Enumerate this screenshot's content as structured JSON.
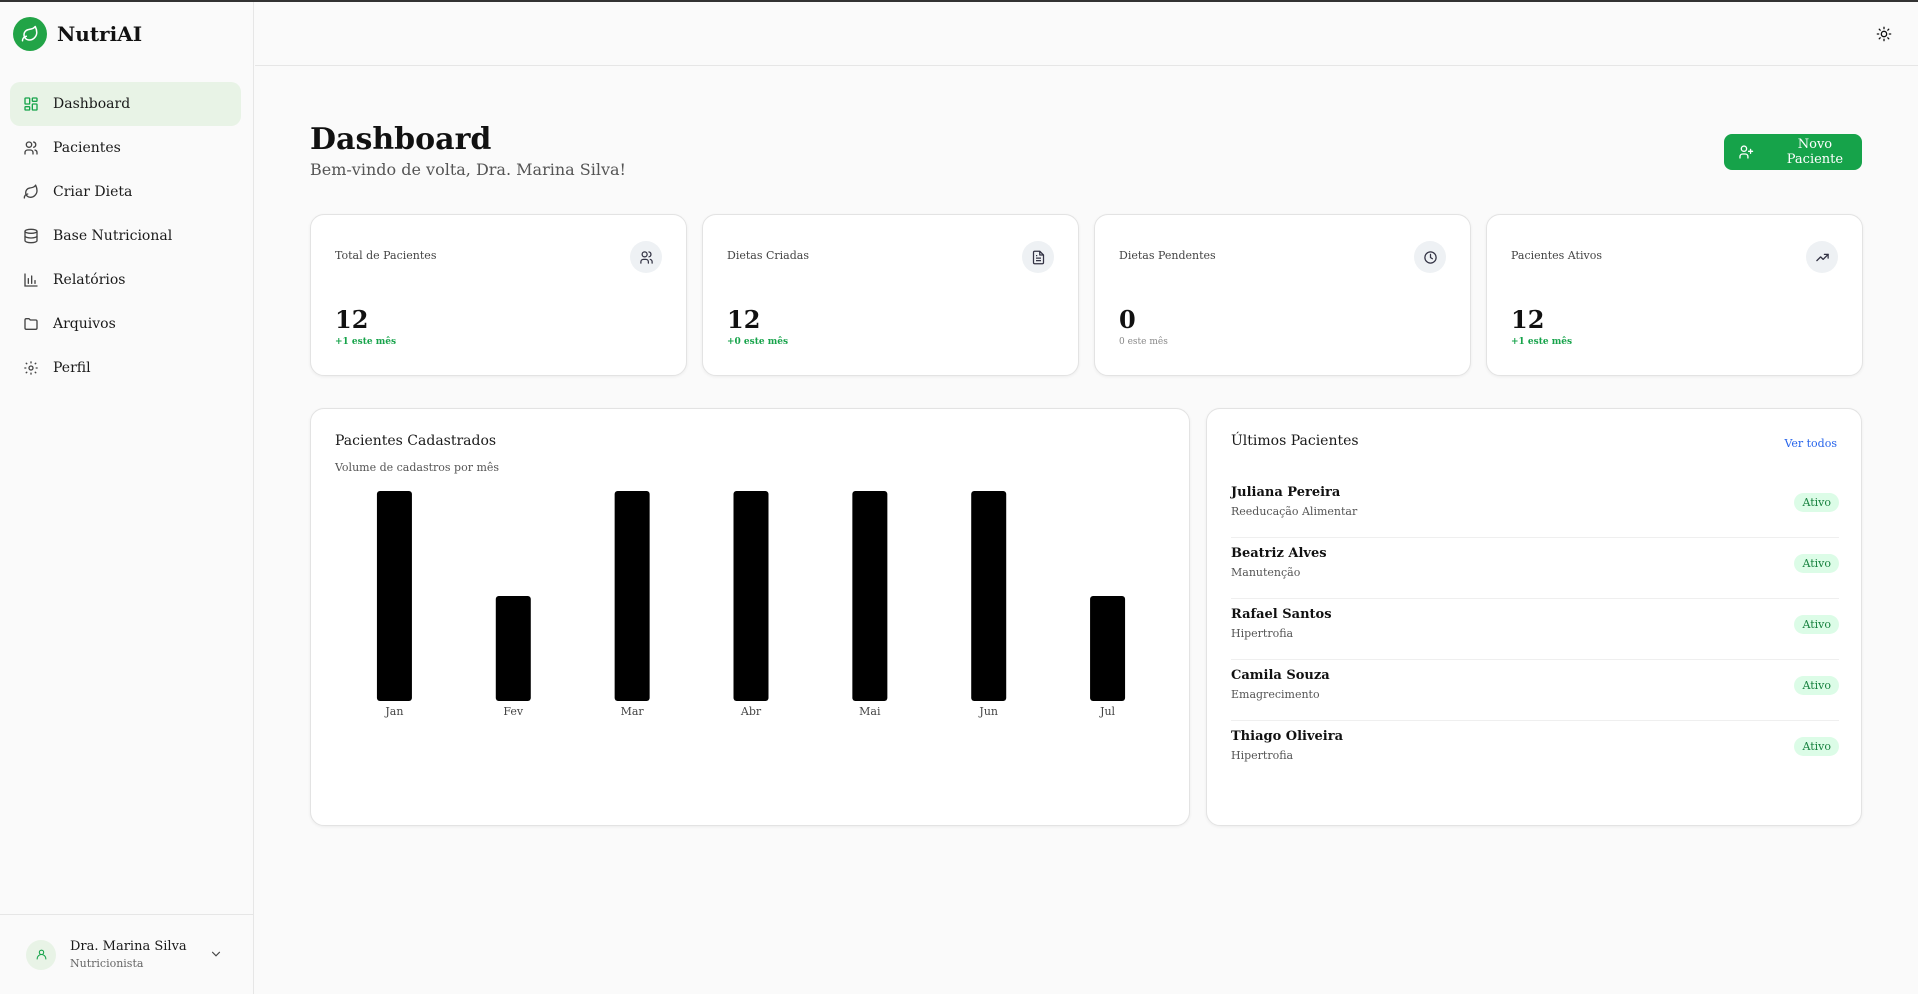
{
  "brand": {
    "name": "NutriAI"
  },
  "sidebar": {
    "items": [
      {
        "label": "Dashboard",
        "icon": "dashboard-icon",
        "active": true
      },
      {
        "label": "Pacientes",
        "icon": "users-icon"
      },
      {
        "label": "Criar Dieta",
        "icon": "leaf-icon"
      },
      {
        "label": "Base Nutricional",
        "icon": "database-icon"
      },
      {
        "label": "Relatórios",
        "icon": "bar-chart-icon"
      },
      {
        "label": "Arquivos",
        "icon": "folder-icon"
      },
      {
        "label": "Perfil",
        "icon": "gear-icon"
      }
    ],
    "user": {
      "name": "Dra. Marina Silva",
      "role": "Nutricionista"
    }
  },
  "header": {
    "theme_icon": "sun-icon"
  },
  "main": {
    "title": "Dashboard",
    "subtitle": "Bem-vindo de volta, Dra. Marina Silva!",
    "new_patient_label": "Novo Paciente"
  },
  "stats": [
    {
      "label": "Total de Pacientes",
      "value": "12",
      "trend": "+1 este mês",
      "icon": "users-icon"
    },
    {
      "label": "Dietas Criadas",
      "value": "12",
      "trend": "+0 este mês",
      "icon": "document-icon"
    },
    {
      "label": "Dietas Pendentes",
      "value": "0",
      "trend": "0 este mês",
      "icon": "clock-icon"
    },
    {
      "label": "Pacientes Ativos",
      "value": "12",
      "trend": "+1 este mês",
      "icon": "trending-up-icon"
    }
  ],
  "chart_card": {
    "title": "Pacientes Cadastrados",
    "subtitle": "Volume de cadastros por mês"
  },
  "chart_data": {
    "type": "bar",
    "categories": [
      "Jan",
      "Fev",
      "Mar",
      "Abr",
      "Mai",
      "Jun",
      "Jul"
    ],
    "values": [
      2,
      1,
      2,
      2,
      2,
      2,
      1
    ],
    "ylim": [
      0,
      2
    ],
    "grid": false,
    "bar_color": "#000000"
  },
  "patients_card": {
    "title": "Últimos Pacientes",
    "see_all": "Ver todos",
    "patients": [
      {
        "name": "Juliana Pereira",
        "goal": "Reeducação Alimentar",
        "status": "Ativo"
      },
      {
        "name": "Beatriz Alves",
        "goal": "Manutenção",
        "status": "Ativo"
      },
      {
        "name": "Rafael Santos",
        "goal": "Hipertrofia",
        "status": "Ativo"
      },
      {
        "name": "Camila Souza",
        "goal": "Emagrecimento",
        "status": "Ativo"
      },
      {
        "name": "Thiago Oliveira",
        "goal": "Hipertrofia",
        "status": "Ativo"
      }
    ]
  },
  "colors": {
    "accent": "#16a34a",
    "active_bg": "#e8f3e6",
    "link": "#2563eb"
  }
}
